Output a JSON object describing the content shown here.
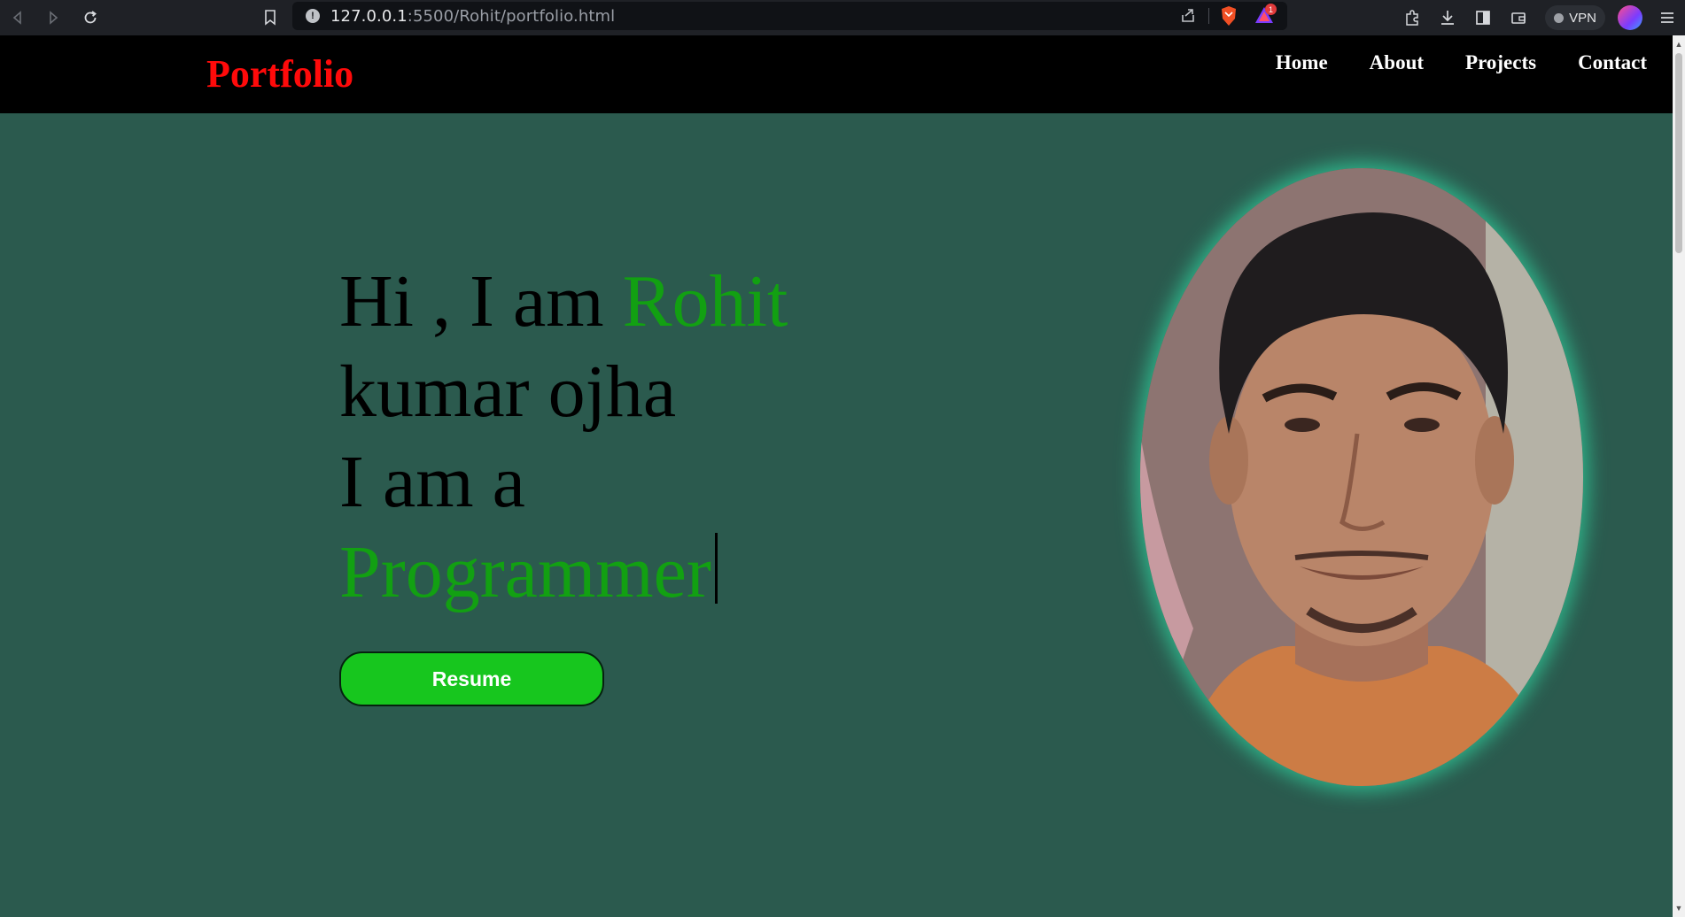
{
  "browser": {
    "url_host": "127.0.0.1",
    "url_rest": ":5500/Rohit/portfolio.html",
    "rewards_count": "1",
    "vpn_label": "VPN"
  },
  "navbar": {
    "brand": "Portfolio",
    "links": [
      "Home",
      "About",
      "Projects",
      "Contact"
    ]
  },
  "hero": {
    "line1_prefix": "Hi , I am ",
    "line1_name": "Rohit",
    "line2": "kumar ojha",
    "line3": "I am a",
    "typed_word": "Programmer",
    "resume_label": "Resume"
  },
  "colors": {
    "background": "#2b5a4e",
    "brand": "#ff0a0a",
    "accent_text": "#12a012",
    "button": "#17c61e",
    "photo_glow": "#2fb48a"
  },
  "icons": [
    "back-icon",
    "forward-icon",
    "reload-icon",
    "bookmark-icon",
    "site-info-icon",
    "share-icon",
    "brave-shield-icon",
    "brave-rewards-icon",
    "extensions-icon",
    "download-icon",
    "sidebar-icon",
    "wallet-icon",
    "menu-icon"
  ]
}
